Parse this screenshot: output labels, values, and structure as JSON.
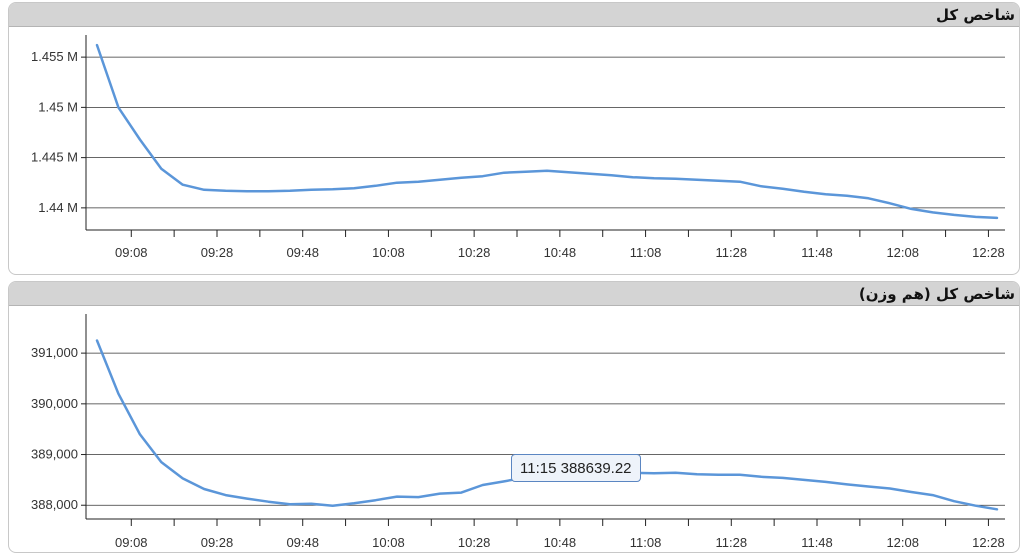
{
  "chart_data": [
    {
      "type": "line",
      "title": "شاخص کل",
      "x": [
        "09:00",
        "09:05",
        "09:10",
        "09:15",
        "09:20",
        "09:25",
        "09:30",
        "09:35",
        "09:40",
        "09:45",
        "09:50",
        "09:55",
        "10:00",
        "10:05",
        "10:10",
        "10:15",
        "10:20",
        "10:25",
        "10:30",
        "10:35",
        "10:40",
        "10:45",
        "10:50",
        "10:55",
        "11:00",
        "11:05",
        "11:10",
        "11:15",
        "11:20",
        "11:25",
        "11:30",
        "11:35",
        "11:40",
        "11:45",
        "11:50",
        "11:55",
        "12:00",
        "12:05",
        "12:10",
        "12:15",
        "12:20",
        "12:25",
        "12:30"
      ],
      "series": [
        {
          "values": [
            1456200,
            1450000,
            1446800,
            1443900,
            1442300,
            1441800,
            1441700,
            1441650,
            1441650,
            1441700,
            1441800,
            1441850,
            1441950,
            1442200,
            1442500,
            1442600,
            1442800,
            1443000,
            1443150,
            1443500,
            1443600,
            1443700,
            1443550,
            1443400,
            1443250,
            1443050,
            1442950,
            1442900,
            1442800,
            1442700,
            1442600,
            1442150,
            1441900,
            1441600,
            1441350,
            1441200,
            1440950,
            1440450,
            1439900,
            1439550,
            1439300,
            1439100,
            1439000
          ]
        }
      ],
      "xticks": [
        "09:08",
        "09:28",
        "09:48",
        "10:08",
        "10:28",
        "10:48",
        "11:08",
        "11:28",
        "11:48",
        "12:08",
        "12:28"
      ],
      "yticks": [
        {
          "value": 1440000,
          "label": "1.44 M"
        },
        {
          "value": 1445000,
          "label": "1.445 M"
        },
        {
          "value": 1450000,
          "label": "1.45 M"
        },
        {
          "value": 1455000,
          "label": "1.455 M"
        }
      ],
      "ylim": [
        1437000,
        1458000
      ],
      "grid": true
    },
    {
      "type": "line",
      "title": "شاخص کل (هم وزن)",
      "x": [
        "09:00",
        "09:05",
        "09:10",
        "09:15",
        "09:20",
        "09:25",
        "09:30",
        "09:35",
        "09:40",
        "09:45",
        "09:50",
        "09:55",
        "10:00",
        "10:05",
        "10:10",
        "10:15",
        "10:20",
        "10:25",
        "10:30",
        "10:35",
        "10:40",
        "10:45",
        "10:50",
        "10:55",
        "11:00",
        "11:05",
        "11:10",
        "11:15",
        "11:20",
        "11:25",
        "11:30",
        "11:35",
        "11:40",
        "11:45",
        "11:50",
        "11:55",
        "12:00",
        "12:05",
        "12:10",
        "12:15",
        "12:20",
        "12:25",
        "12:30"
      ],
      "series": [
        {
          "values": [
            391250,
            390200,
            389400,
            388850,
            388530,
            388320,
            388200,
            388130,
            388070,
            388020,
            388030,
            387990,
            388040,
            388100,
            388170,
            388160,
            388230,
            388250,
            388400,
            388470,
            388550,
            388600,
            388630,
            388640,
            388650,
            388640,
            388630,
            388639.22,
            388610,
            388600,
            388600,
            388560,
            388540,
            388500,
            388460,
            388410,
            388370,
            388330,
            388260,
            388200,
            388080,
            387990,
            387920
          ]
        }
      ],
      "xticks": [
        "09:08",
        "09:28",
        "09:48",
        "10:08",
        "10:28",
        "10:48",
        "11:08",
        "11:28",
        "11:48",
        "12:08",
        "12:28"
      ],
      "yticks": [
        {
          "value": 388000,
          "label": "388,000"
        },
        {
          "value": 389000,
          "label": "389,000"
        },
        {
          "value": 390000,
          "label": "390,000"
        },
        {
          "value": 391000,
          "label": "391,000"
        }
      ],
      "ylim": [
        387610,
        391930
      ],
      "grid": true,
      "tooltip": {
        "time": "11:15",
        "value": "388639.22"
      }
    }
  ]
}
